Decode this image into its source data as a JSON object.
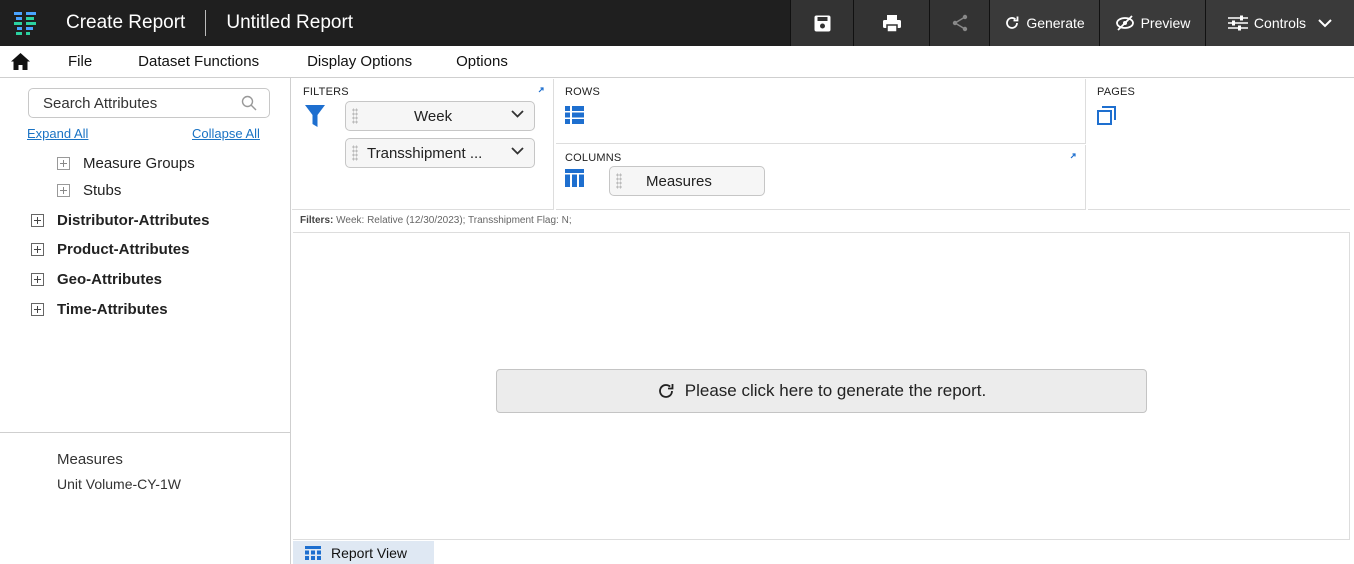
{
  "topbar": {
    "title": "Create Report",
    "report_name": "Untitled Report",
    "generate_label": "Generate",
    "preview_label": "Preview",
    "controls_label": "Controls"
  },
  "menu": {
    "items": [
      "File",
      "Dataset Functions",
      "Display Options",
      "Options"
    ]
  },
  "sidebar": {
    "search_placeholder": "Search Attributes",
    "expand_all": "Expand All",
    "collapse_all": "Collapse All",
    "tree": [
      {
        "label": "Measure Groups",
        "bold": false
      },
      {
        "label": "Stubs",
        "bold": false
      },
      {
        "label": "Distributor-Attributes",
        "bold": true
      },
      {
        "label": "Product-Attributes",
        "bold": true
      },
      {
        "label": "Geo-Attributes",
        "bold": true
      },
      {
        "label": "Time-Attributes",
        "bold": true
      }
    ],
    "measures_title": "Measures",
    "measures_items": [
      "Unit Volume-CY-1W"
    ]
  },
  "zones": {
    "filters_label": "FILTERS",
    "filter_pills": [
      "Week",
      "Transshipment ..."
    ],
    "rows_label": "ROWS",
    "columns_label": "COLUMNS",
    "column_pills": [
      "Measures"
    ],
    "pages_label": "PAGES"
  },
  "filters_summary": {
    "label": "Filters:",
    "text": "Week: Relative (12/30/2023); Transshipment Flag: N;"
  },
  "main": {
    "generate_prompt": "Please click here to generate the report."
  },
  "tabs": {
    "report_view": "Report View"
  },
  "colors": {
    "topbar_bg": "#1f1f1f",
    "accent_blue": "#1a73c4",
    "icon_blue": "#1e6fcf"
  }
}
